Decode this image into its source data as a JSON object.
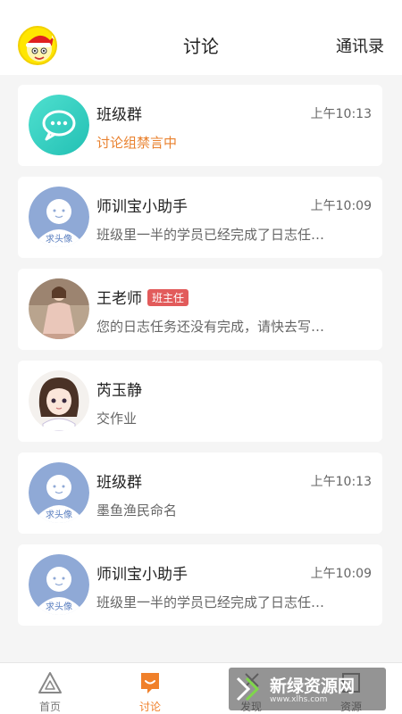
{
  "header": {
    "title": "讨论",
    "contacts_label": "通讯录"
  },
  "conversations": [
    {
      "name": "班级群",
      "time": "上午10:13",
      "message": "讨论组禁言中",
      "avatar": "chat-bubble-icon"
    },
    {
      "name": "师训宝小助手",
      "time": "上午10:09",
      "message": "班级里一半的学员已经完成了日志任…",
      "avatar_text": "求头像"
    },
    {
      "name": "王老师",
      "badge": "班主任",
      "message": "您的日志任务还没有完成，请快去写…"
    },
    {
      "name": "芮玉静",
      "message": "交作业"
    },
    {
      "name": "班级群",
      "time": "上午10:13",
      "message": "墨鱼渔民命名",
      "avatar_text": "求头像"
    },
    {
      "name": "师训宝小助手",
      "time": "上午10:09",
      "message": "班级里一半的学员已经完成了日志任…",
      "avatar_text": "求头像"
    }
  ],
  "nav": {
    "tabs": [
      {
        "label": "首页",
        "icon": "triangle-icon"
      },
      {
        "label": "讨论",
        "icon": "chat-icon",
        "active": true
      },
      {
        "label": "发现",
        "icon": "discover-icon"
      },
      {
        "label": "资源",
        "icon": "resource-icon"
      }
    ]
  },
  "watermark": {
    "text": "新绿资源网",
    "url": "www.xlhs.com"
  },
  "colors": {
    "accent": "#f0802a",
    "badge": "#e25b5b",
    "teal": "#3fd3c3"
  }
}
